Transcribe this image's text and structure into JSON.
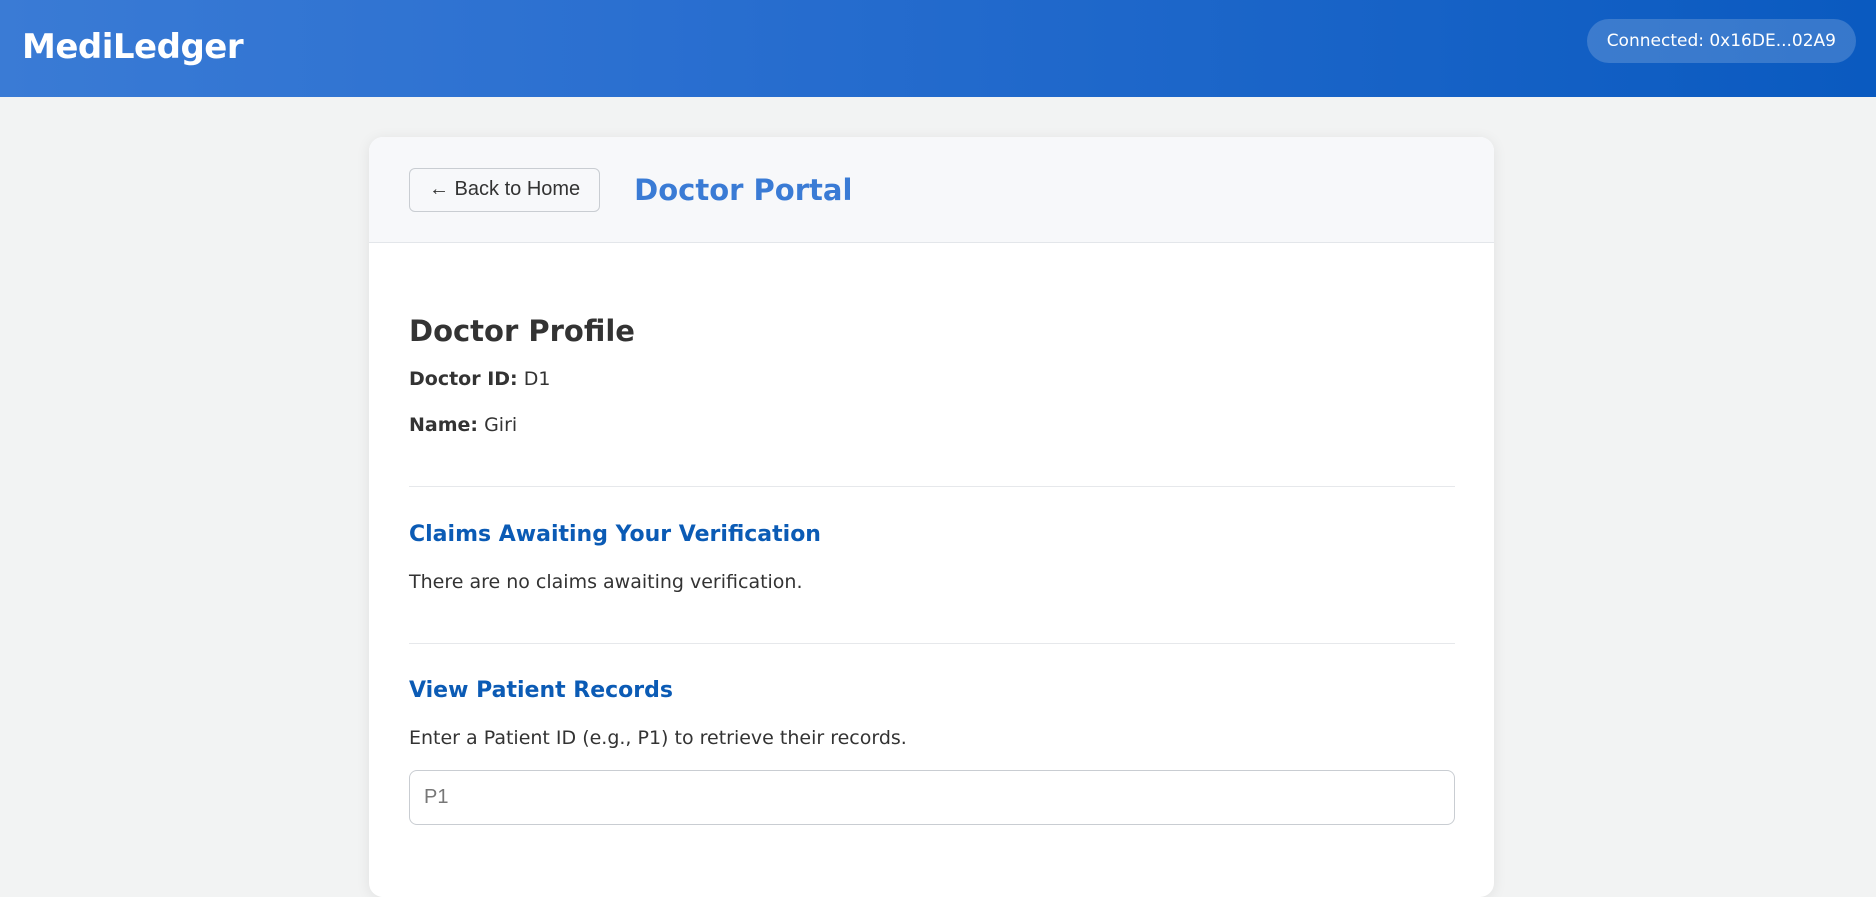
{
  "app": {
    "brand": "MediLedger",
    "connection": "Connected: 0x16DE...02A9"
  },
  "header": {
    "back_label": "← Back to Home",
    "portal_title": "Doctor Portal"
  },
  "profile": {
    "title": "Doctor Profile",
    "doctor_id_label": "Doctor ID:",
    "doctor_id_value": "D1",
    "name_label": "Name:",
    "name_value": "Giri"
  },
  "claims": {
    "title": "Claims Awaiting Your Verification",
    "empty_text": "There are no claims awaiting verification."
  },
  "records": {
    "title": "View Patient Records",
    "instructions": "Enter a Patient ID (e.g., P1) to retrieve their records.",
    "input_value": "",
    "input_placeholder": "P1"
  },
  "colors": {
    "accent": "#3a7bd5",
    "section": "#0b5bb5"
  }
}
